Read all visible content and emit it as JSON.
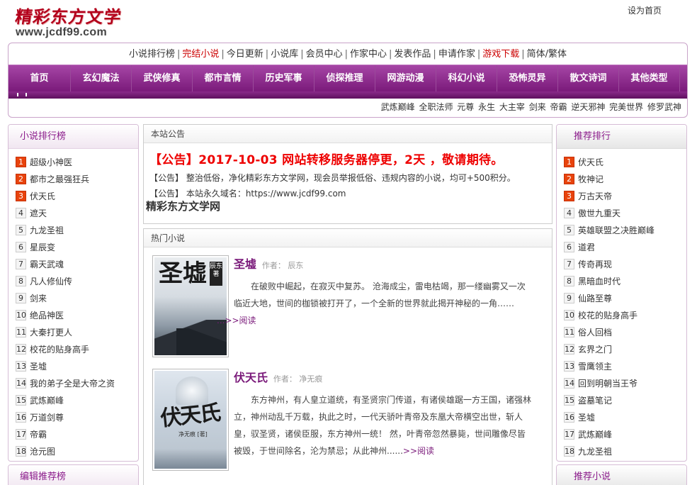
{
  "logo": {
    "cn": "精彩东方文学",
    "url": "www.jcdf99.com"
  },
  "sethome": "设为首页",
  "toplinks": [
    {
      "label": "小说排行榜",
      "red": false
    },
    {
      "label": "完结小说",
      "red": true
    },
    {
      "label": "今日更新",
      "red": false
    },
    {
      "label": "小说库",
      "red": false
    },
    {
      "label": "会员中心",
      "red": false
    },
    {
      "label": "作家中心",
      "red": false
    },
    {
      "label": "发表作品",
      "red": false
    },
    {
      "label": "申请作家",
      "red": false
    },
    {
      "label": "游戏下载",
      "red": true
    },
    {
      "label": "简体/繁体",
      "red": false
    }
  ],
  "nav": [
    "首页",
    "玄幻魔法",
    "武侠修真",
    "都市言情",
    "历史军事",
    "侦探推理",
    "网游动漫",
    "科幻小说",
    "恐怖灵异",
    "散文诗词",
    "其他类型"
  ],
  "hotwords": "武炼巅峰 全职法师 元尊 永生 大主宰 剑来 帝霸 逆天邪神 完美世界 修罗武神",
  "left": {
    "title": "小说排行榜",
    "items": [
      "超级小神医",
      "都市之最强狂兵",
      "伏天氏",
      "遮天",
      "九龙圣祖",
      "星辰变",
      "霸天武魂",
      "凡人修仙传",
      "剑来",
      "绝品神医",
      "大秦打更人",
      "校花的贴身高手",
      "圣墟",
      "我的弟子全是大帝之资",
      "武炼巅峰",
      "万道剑尊",
      "帝霸",
      "沧元图"
    ],
    "title2": "编辑推荐榜"
  },
  "right": {
    "title": "推荐排行",
    "items": [
      "伏天氏",
      "牧神记",
      "万古天帝",
      "傲世九重天",
      "英雄联盟之决胜巅峰",
      "道君",
      "传奇再现",
      "黑暗血时代",
      "仙路至尊",
      "校花的贴身高手",
      "俗人回档",
      "玄界之门",
      "雪鹰领主",
      "回到明朝当王爷",
      "盗墓笔记",
      "圣墟",
      "武炼巅峰",
      "九龙圣祖"
    ],
    "title2": "推荐小说"
  },
  "notice": {
    "header": "本站公告",
    "headline": "【公告】2017-10-03 网站转移服务器停更，2天 ，敬请期待。",
    "line1": "【公告】 整治低俗，净化精彩东方文学网，现会员举报低俗、违规内容的小说，均可+500积分。",
    "line2": "【公告】 本站永久域名：https://www.jcdf99.com",
    "site": "精彩东方文学网"
  },
  "hot": {
    "header": "热门小说",
    "books": [
      {
        "title": "圣墟",
        "author": "作者：  辰东",
        "cover_text": "圣墟",
        "cover_seal": "辰东著",
        "desc": "在破败中崛起，在寂灭中复苏。 沧海成尘，雷电枯竭，那一缕幽雾又一次临近大地，世间的枷锁被打开了，一个全新的世界就此揭开神秘的一角……",
        "more": "...>>阅读"
      },
      {
        "title": "伏天氏",
        "author": "作者：  净无痕",
        "cover_text": "伏天氏",
        "cover_author": "净无痕 [著]",
        "desc": "东方神州，有人皇立道统，有圣贤宗门传道，有诸侯雄踞一方王国，诸强林立，神州动乱千万载，执此之时，一代天骄叶青帝及东凰大帝横空出世，斩人皇，驭圣贤，诸侯臣服，东方神州一统！ 然，叶青帝忽然暴毙，世间雕像尽皆被毁，于世间除名，沦为禁忌；从此神州......",
        "more": ">>阅读"
      }
    ]
  }
}
